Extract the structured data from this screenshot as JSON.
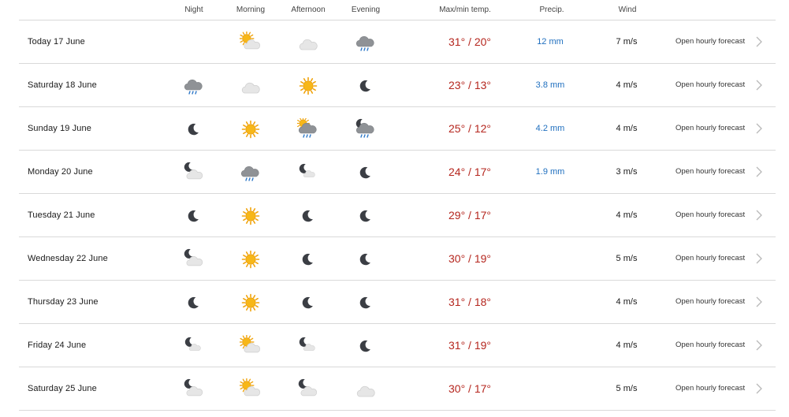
{
  "headers": {
    "night": "Night",
    "morning": "Morning",
    "afternoon": "Afternoon",
    "evening": "Evening",
    "temp": "Max/min temp.",
    "precip": "Precip.",
    "wind": "Wind"
  },
  "hourly_label": "Open hourly forecast",
  "colors": {
    "temp": "#b5261e",
    "precip": "#1f6fbf",
    "divider": "#d9d9d9"
  },
  "days": [
    {
      "name": "Today 17 June",
      "night": "",
      "morning": "sun-cloud",
      "afternoon": "cloud",
      "evening": "cloud-rain-dark",
      "temp": "31° / 20°",
      "precip": "12 mm",
      "wind": "7 m/s"
    },
    {
      "name": "Saturday 18 June",
      "night": "cloud-rain-dark",
      "morning": "cloud",
      "afternoon": "sun",
      "evening": "moon",
      "temp": "23° / 13°",
      "precip": "3.8 mm",
      "wind": "4 m/s"
    },
    {
      "name": "Sunday 19 June",
      "night": "moon",
      "morning": "sun",
      "afternoon": "sun-cloud-rain",
      "evening": "moon-cloud-rain",
      "temp": "25° / 12°",
      "precip": "4.2 mm",
      "wind": "4 m/s"
    },
    {
      "name": "Monday 20 June",
      "night": "moon-cloud",
      "morning": "cloud-rain-dark",
      "afternoon": "moon-small-cloud",
      "evening": "moon",
      "temp": "24° / 17°",
      "precip": "1.9 mm",
      "wind": "3 m/s"
    },
    {
      "name": "Tuesday 21 June",
      "night": "moon",
      "morning": "sun",
      "afternoon": "moon",
      "evening": "moon",
      "temp": "29° / 17°",
      "precip": "",
      "wind": "4 m/s"
    },
    {
      "name": "Wednesday 22 June",
      "night": "moon-cloud",
      "morning": "sun",
      "afternoon": "moon",
      "evening": "moon",
      "temp": "30° / 19°",
      "precip": "",
      "wind": "5 m/s"
    },
    {
      "name": "Thursday 23 June",
      "night": "moon",
      "morning": "sun",
      "afternoon": "moon",
      "evening": "moon",
      "temp": "31° / 18°",
      "precip": "",
      "wind": "4 m/s"
    },
    {
      "name": "Friday 24 June",
      "night": "moon-small-cloud",
      "morning": "sun-cloud",
      "afternoon": "moon-small-cloud",
      "evening": "moon",
      "temp": "31° / 19°",
      "precip": "",
      "wind": "4 m/s"
    },
    {
      "name": "Saturday 25 June",
      "night": "moon-cloud",
      "morning": "sun-cloud",
      "afternoon": "moon-cloud",
      "evening": "cloud",
      "temp": "30° / 17°",
      "precip": "",
      "wind": "5 m/s"
    }
  ]
}
